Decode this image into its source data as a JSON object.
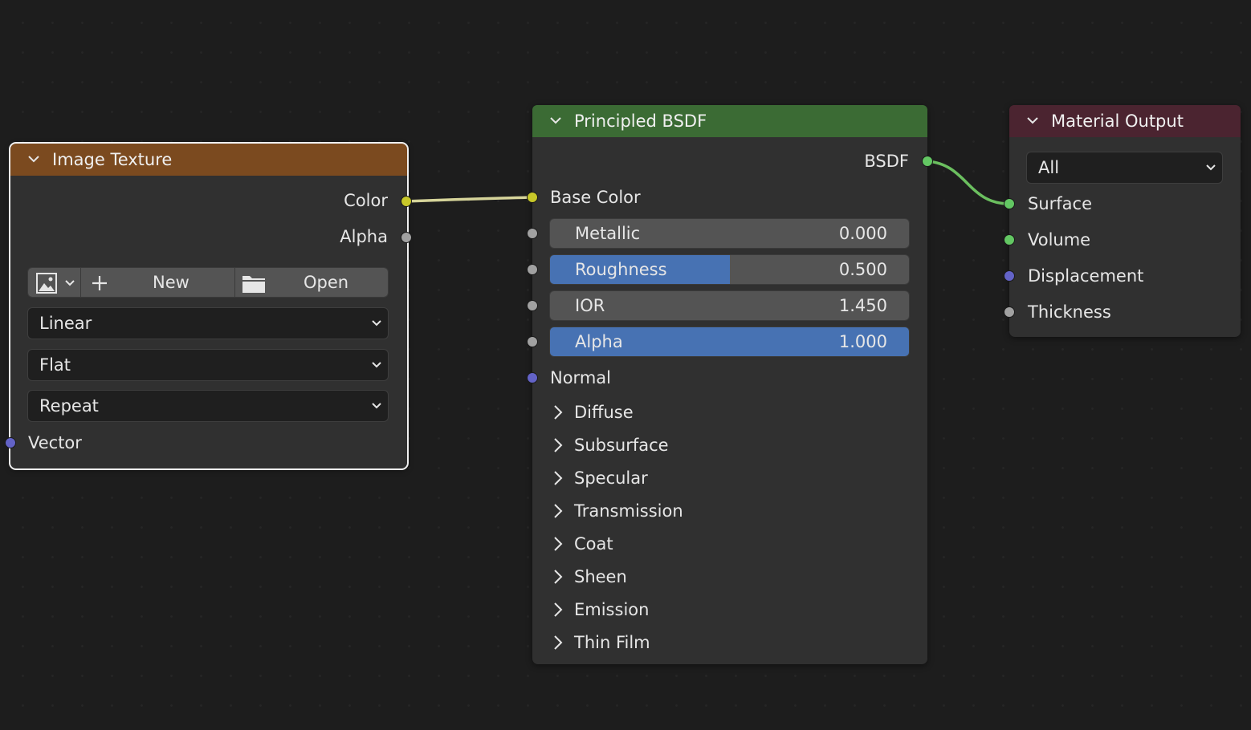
{
  "colors": {
    "image_texture_header": "#7b4a1f",
    "principled_header": "#3b6b34",
    "material_output_header": "#4b2430",
    "link_color": "#d6d49a",
    "link_bsdf": "#6bbf5f",
    "accent_blue": "#4772b3"
  },
  "image_texture": {
    "title": "Image Texture",
    "outputs": {
      "color": "Color",
      "alpha": "Alpha"
    },
    "image_picker_icon": "image-icon",
    "new_label": "New",
    "open_label": "Open",
    "interpolation": "Linear",
    "projection": "Flat",
    "extension": "Repeat",
    "vector_label": "Vector"
  },
  "principled": {
    "title": "Principled BSDF",
    "output": "BSDF",
    "base_color": "Base Color",
    "fields": [
      {
        "label": "Metallic",
        "value": "0.000",
        "fill": 0.0
      },
      {
        "label": "Roughness",
        "value": "0.500",
        "fill": 0.5
      },
      {
        "label": "IOR",
        "value": "1.450",
        "fill": 0.0
      },
      {
        "label": "Alpha",
        "value": "1.000",
        "fill": 1.0
      }
    ],
    "normal": "Normal",
    "panels": [
      "Diffuse",
      "Subsurface",
      "Specular",
      "Transmission",
      "Coat",
      "Sheen",
      "Emission",
      "Thin Film"
    ]
  },
  "material_output": {
    "title": "Material Output",
    "target": "All",
    "inputs": [
      "Surface",
      "Volume",
      "Displacement",
      "Thickness"
    ]
  }
}
